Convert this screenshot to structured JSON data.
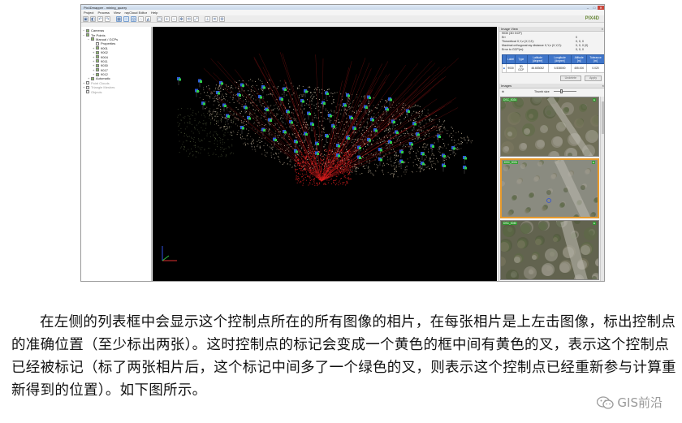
{
  "window": {
    "title": "Pix4Dmapper - mining_quarry",
    "controls": [
      "–",
      "□",
      "✕"
    ]
  },
  "menu": [
    "Project",
    "Process",
    "View",
    "rayCloud Editor",
    "Help"
  ],
  "toolbar_icons": [
    "open-icon",
    "save-icon",
    "undo-icon",
    "redo-icon",
    "cameras-icon",
    "tiepoints-icon",
    "gcp-icon",
    "points-icon",
    "mesh-icon",
    "select-icon",
    "zoom-in-icon",
    "zoom-out-icon",
    "pan-icon",
    "rotate-icon",
    "fit-icon",
    "measure-icon",
    "delete-icon",
    "settings-icon"
  ],
  "logo": {
    "line1": "PIX4D",
    "line2": ""
  },
  "layers": [
    {
      "label": "Cameras",
      "level": 0,
      "checked": true,
      "toggle": "−",
      "dim": false
    },
    {
      "label": "Tie Points",
      "level": 0,
      "checked": true,
      "toggle": "−",
      "dim": false
    },
    {
      "label": "Manual / GCPs",
      "level": 1,
      "checked": true,
      "toggle": "−",
      "dim": false
    },
    {
      "label": "Properties",
      "level": 2,
      "checked": false,
      "toggle": "",
      "dim": false
    },
    {
      "label": "9001",
      "level": 2,
      "checked": true,
      "toggle": "+",
      "dim": false
    },
    {
      "label": "9002",
      "level": 2,
      "checked": true,
      "toggle": "+",
      "dim": false
    },
    {
      "label": "9004",
      "level": 2,
      "checked": true,
      "toggle": "+",
      "dim": false
    },
    {
      "label": "9011",
      "level": 2,
      "checked": true,
      "toggle": "+",
      "dim": false
    },
    {
      "label": "9030",
      "level": 2,
      "checked": true,
      "toggle": "+",
      "dim": false
    },
    {
      "label": "9017",
      "level": 2,
      "checked": true,
      "toggle": "+",
      "dim": false
    },
    {
      "label": "9012",
      "level": 2,
      "checked": true,
      "toggle": "+",
      "dim": false
    },
    {
      "label": "Automatic",
      "level": 1,
      "checked": true,
      "toggle": "+",
      "dim": false
    },
    {
      "label": "Point Clouds",
      "level": 0,
      "checked": false,
      "toggle": "+",
      "dim": true
    },
    {
      "label": "Triangle Meshes",
      "level": 0,
      "checked": false,
      "toggle": "+",
      "dim": true
    },
    {
      "label": "Objects",
      "level": 0,
      "checked": false,
      "toggle": "",
      "dim": true
    }
  ],
  "image_view": {
    "header": "Image View",
    "gcp_name": "9030 (3D GCP)",
    "rows": [
      {
        "key": "Err",
        "value": "0"
      },
      {
        "key": "Theoretical X,Y,z (X,Y,Z):",
        "value": "0, 0, 0"
      },
      {
        "key": "Maximal orthogonal ray distance X,Y,z (X,Y,Z):",
        "value": "0, 0, 0 (0)"
      },
      {
        "key": "Error to GCP(m):",
        "value": "0, 0, 0"
      }
    ],
    "table_headers": [
      "",
      "Label",
      "Type",
      "Latitude [degree]",
      "Longitude [degree]",
      "Altitude [m]",
      "Tolerance [m]"
    ],
    "table_row": [
      "■",
      "9030",
      "3D GCP",
      "46.653052",
      "6.538000",
      "455.000",
      "0.020"
    ],
    "buttons": [
      "Undelete",
      "Apply"
    ]
  },
  "images_panel": {
    "header": "Images",
    "thumb_label": "Thumb size",
    "thumbs": [
      {
        "label": "DSC_0024",
        "label2": "",
        "selected": false
      },
      {
        "label": "DSC_0031",
        "label2": "",
        "selected": true
      },
      {
        "label": "DSC_0040",
        "label2": "",
        "selected": false
      }
    ]
  },
  "axes": {
    "x": "x",
    "y": "y",
    "z": "z"
  },
  "paragraph": "在左侧的列表框中会显示这个控制点所在的所有图像的相片，在每张相片是上左击图像，标出控制点的准确位置（至少标出两张）。这时控制点的标记会变成一个黄色的框中间有黄色的叉，表示这个控制点已经被标记（标了两张相片后，这个标记中间多了一个绿色的叉，则表示这个控制点已经重新参与计算重新得到的位置）。如下图所示。",
  "watermark": "GIS前沿",
  "colors": {
    "camera_blue": "#2f5bd8",
    "camera_green": "#2fcf4a",
    "gcp_red": "#e02020",
    "accent": "#3f75c9",
    "selected_border": "#e89a2c"
  }
}
